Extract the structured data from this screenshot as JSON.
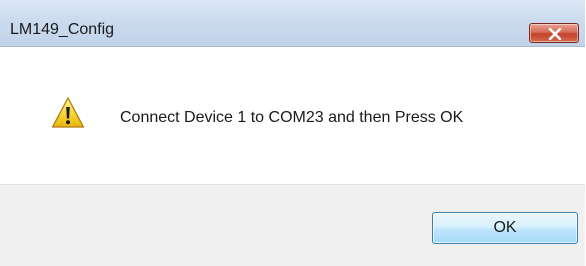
{
  "window": {
    "title": "LM149_Config"
  },
  "dialog": {
    "message": "Connect Device 1 to COM23 and then Press OK",
    "icon": "warning-icon",
    "ok_label": "OK"
  },
  "colors": {
    "titlebar": "#c9d9ee",
    "close_button": "#c4432b",
    "warning_yellow": "#f5cf2a",
    "footer": "#f0f0f0",
    "ok_border": "#3c7fb1"
  }
}
